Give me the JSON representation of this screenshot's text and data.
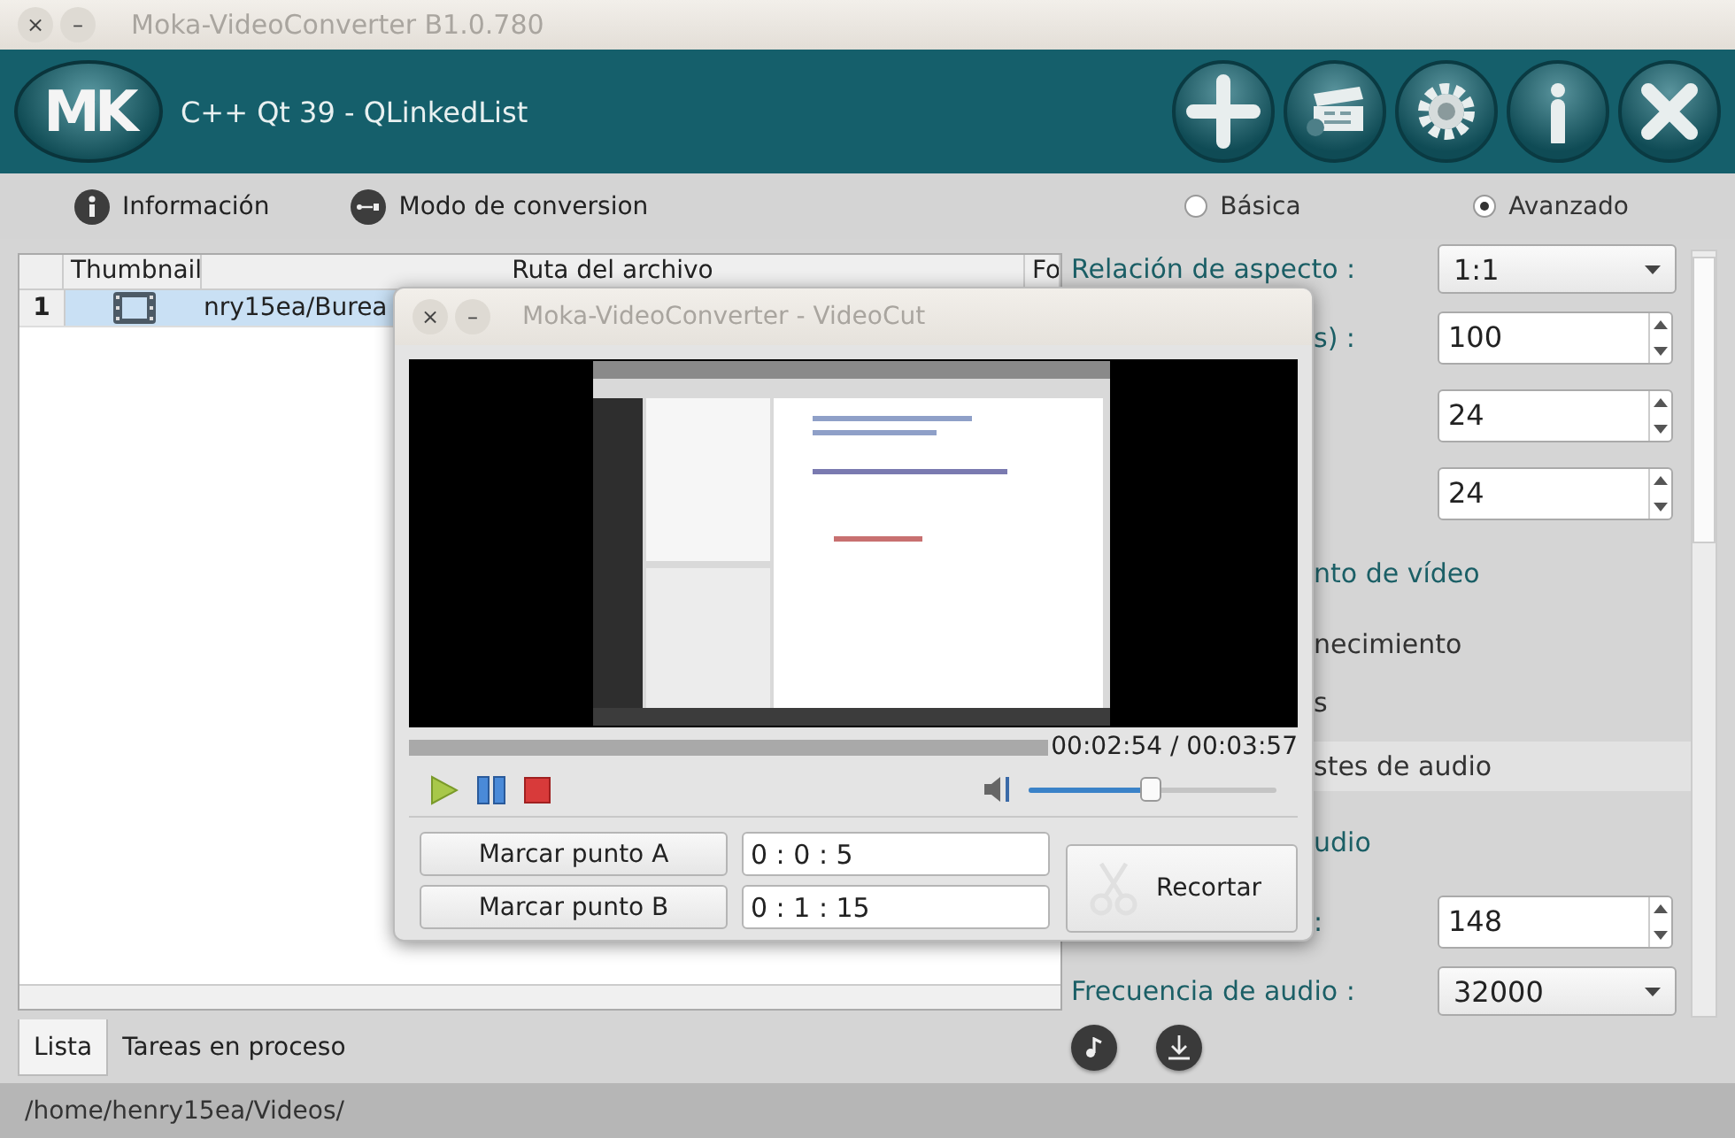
{
  "window": {
    "title": "Moka-VideoConverter B1.0.780",
    "controls": [
      "×",
      "–"
    ]
  },
  "header": {
    "logo": "MK",
    "title": "C++ Qt 39 - QLinkedList",
    "buttons": [
      {
        "kind": "add"
      },
      {
        "kind": "clapper"
      },
      {
        "kind": "settings"
      },
      {
        "kind": "info"
      },
      {
        "kind": "close"
      }
    ]
  },
  "toolbar": {
    "items": [
      {
        "kind": "info",
        "label": "Información"
      },
      {
        "kind": "mode",
        "label": "Modo de conversion"
      }
    ],
    "modes": [
      {
        "label": "Básica",
        "selected": false
      },
      {
        "label": "Avanzado",
        "selected": true
      }
    ]
  },
  "table": {
    "columns": [
      "Thumbnail",
      "Ruta del archivo",
      "Fo"
    ],
    "rows": [
      {
        "number": "1",
        "path": "nry15ea/Burea",
        "selected": true
      }
    ]
  },
  "tabs": [
    {
      "label": "Lista",
      "selected": true
    },
    {
      "label": "Tareas en proceso",
      "selected": false
    }
  ],
  "settings": {
    "rows": [
      {
        "kind": "combo",
        "label": "Relación de aspecto :",
        "value": "1:1"
      },
      {
        "kind": "spin",
        "label": "s) :",
        "value": "100",
        "covered": true
      },
      {
        "kind": "spin",
        "value": "24"
      },
      {
        "kind": "spin",
        "value": "24"
      },
      {
        "kind": "heading",
        "label": "nto de vídeo",
        "covered": true
      },
      {
        "kind": "text",
        "label": "necimiento",
        "covered": true
      },
      {
        "kind": "text",
        "label": "s",
        "covered": true
      },
      {
        "kind": "band",
        "label": "stes de audio",
        "covered": true
      },
      {
        "kind": "heading",
        "label": "udio",
        "covered": true
      },
      {
        "kind": "spin",
        "label": ":",
        "value": "148",
        "covered": true
      },
      {
        "kind": "combo",
        "label": "Frecuencia de audio :",
        "value": "32000"
      },
      {
        "kind": "stub"
      }
    ]
  },
  "bottom_icons": [
    {
      "kind": "audio"
    },
    {
      "kind": "download"
    }
  ],
  "status_bar": "/home/henry15ea/Videos/",
  "dialog": {
    "title": "Moka-VideoConverter - VideoCut",
    "controls": [
      "×",
      "–"
    ],
    "video": {
      "kind": "picture"
    },
    "time": "00:02:54 / 00:03:57",
    "volume": {
      "level": 0.49
    },
    "marks": [
      {
        "label": "Marcar punto A",
        "value": "0 : 0 : 5"
      },
      {
        "label": "Marcar punto B",
        "value": "0 : 1 : 15"
      }
    ],
    "cut_button": "Recortar"
  }
}
